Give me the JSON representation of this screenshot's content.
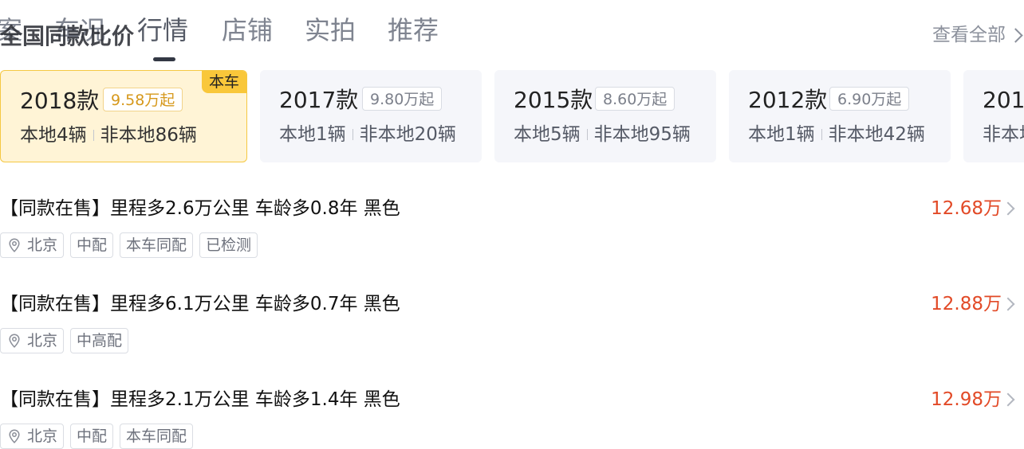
{
  "tabs": [
    {
      "label": "案"
    },
    {
      "label": "车况"
    },
    {
      "label": "行情"
    },
    {
      "label": "店铺"
    },
    {
      "label": "实拍"
    },
    {
      "label": "推荐"
    }
  ],
  "section_title": "全国同款比价",
  "view_all": "查看全部",
  "badge_this_car": "本车",
  "cards": [
    {
      "year": "2018款",
      "price": "9.58万起",
      "local": "本地4辆",
      "nonlocal": "非本地86辆"
    },
    {
      "year": "2017款",
      "price": "9.80万起",
      "local": "本地1辆",
      "nonlocal": "非本地20辆"
    },
    {
      "year": "2015款",
      "price": "8.60万起",
      "local": "本地5辆",
      "nonlocal": "非本地95辆"
    },
    {
      "year": "2012款",
      "price": "6.90万起",
      "local": "本地1辆",
      "nonlocal": "非本地42辆"
    },
    {
      "year": "201",
      "price": "",
      "local": "",
      "nonlocal": "非本地"
    }
  ],
  "listings": [
    {
      "title": "【同款在售】里程多2.6万公里 车龄多0.8年 黑色",
      "price": "12.68万",
      "tags": [
        "北京",
        "中配",
        "本车同配",
        "已检测"
      ]
    },
    {
      "title": "【同款在售】里程多6.1万公里 车龄多0.7年 黑色",
      "price": "12.88万",
      "tags": [
        "北京",
        "中高配"
      ]
    },
    {
      "title": "【同款在售】里程多2.1万公里 车龄多1.4年 黑色",
      "price": "12.98万",
      "tags": [
        "北京",
        "中配",
        "本车同配"
      ]
    }
  ],
  "colors": {
    "price_red": "#e24a27",
    "selected_bg": "#fff4d6",
    "badge_yellow": "#f9c73a"
  }
}
